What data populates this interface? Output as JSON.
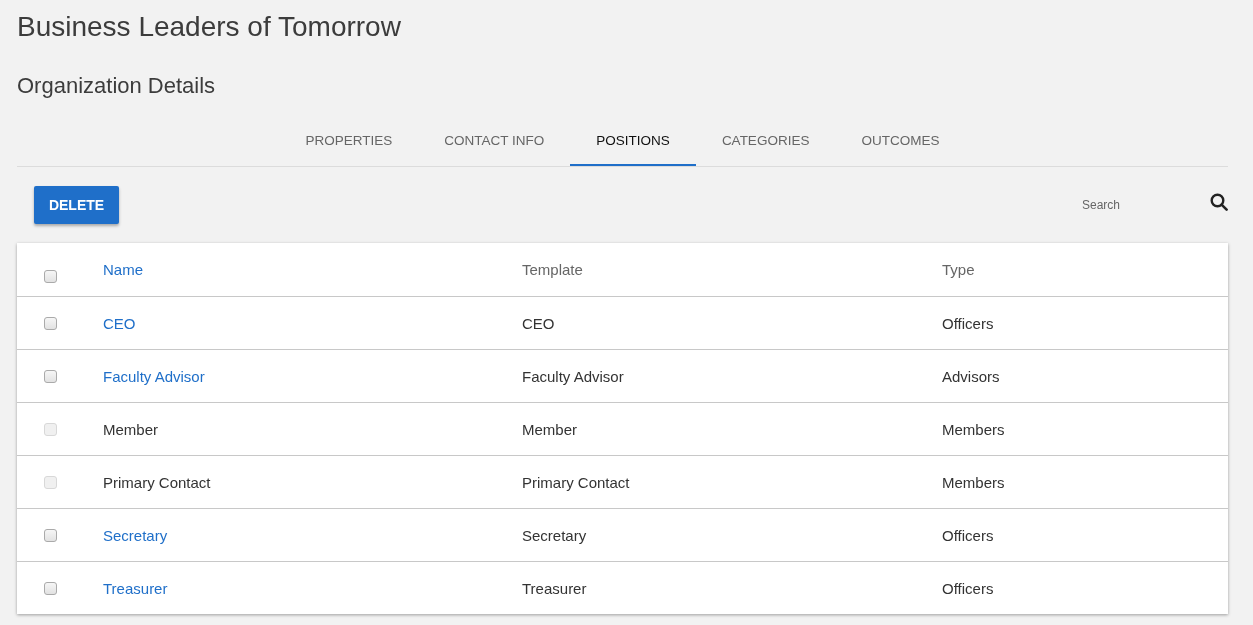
{
  "page": {
    "title": "Business Leaders of Tomorrow",
    "subtitle": "Organization Details"
  },
  "tabs": [
    {
      "label": "PROPERTIES",
      "selected": false
    },
    {
      "label": "CONTACT INFO",
      "selected": false
    },
    {
      "label": "POSITIONS",
      "selected": true
    },
    {
      "label": "CATEGORIES",
      "selected": false
    },
    {
      "label": "OUTCOMES",
      "selected": false
    }
  ],
  "toolbar": {
    "delete_button": "DELETE",
    "search": {
      "placeholder": "Search"
    }
  },
  "table": {
    "select_all": {
      "checked": false
    },
    "columns": [
      {
        "label": "Name",
        "link": true
      },
      {
        "label": "Template",
        "link": false
      },
      {
        "label": "Type",
        "link": false
      }
    ],
    "rows": [
      {
        "name": "CEO",
        "link": true,
        "template": "CEO",
        "type": "Officers",
        "checked": false,
        "disabled": false
      },
      {
        "name": "Faculty Advisor",
        "link": true,
        "template": "Faculty Advisor",
        "type": "Advisors",
        "checked": false,
        "disabled": false
      },
      {
        "name": "Member",
        "link": false,
        "template": "Member",
        "type": "Members",
        "checked": false,
        "disabled": true
      },
      {
        "name": "Primary Contact",
        "link": false,
        "template": "Primary Contact",
        "type": "Members",
        "checked": false,
        "disabled": true
      },
      {
        "name": "Secretary",
        "link": true,
        "template": "Secretary",
        "type": "Officers",
        "checked": false,
        "disabled": false
      },
      {
        "name": "Treasurer",
        "link": true,
        "template": "Treasurer",
        "type": "Officers",
        "checked": false,
        "disabled": false
      }
    ]
  }
}
